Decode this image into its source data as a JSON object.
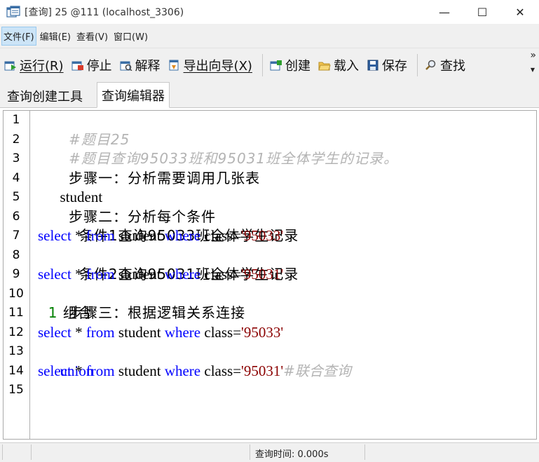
{
  "window": {
    "title": "[查询] 25 @111 (localhost_3306)",
    "minimize": "—",
    "maximize": "☐",
    "close": "✕"
  },
  "menubar": {
    "items": [
      "文件(F)",
      "编辑(E)",
      "查看(V)",
      "窗口(W)"
    ]
  },
  "toolbar": {
    "run": "运行(R)",
    "stop": "停止",
    "explain": "解释",
    "export_wizard": "导出向导(X)",
    "create": "创建",
    "load": "载入",
    "save": "保存",
    "find": "查找",
    "more": "»"
  },
  "tabs": {
    "query_builder": "查询创建工具",
    "query_editor": "查询编辑器"
  },
  "editor": {
    "line_numbers": [
      "1",
      "2",
      "3",
      "4",
      "5",
      "6",
      "7",
      "8",
      "9",
      "10",
      "11",
      "12",
      "13",
      "14",
      "15"
    ],
    "lines": {
      "l1": "#题目25",
      "l2": "#题目查询95033班和95031班全体学生的记录。",
      "l3": "步骤一：分析需要调用几张表",
      "l4": "student",
      "l5": "步骤二：分析每个条件",
      "l6": "  条件1查询95033班全体学生记录",
      "l7_kw1": "select",
      "l7_p1": " * ",
      "l7_kw2": "from",
      "l7_p2": " student ",
      "l7_kw3": "where",
      "l7_p3": " class=",
      "l7_str": "'95033'",
      "l8": "  条件2查询95031班全体学生记录",
      "l9_kw1": "select",
      "l9_p1": " * ",
      "l9_kw2": "from",
      "l9_p2": " student ",
      "l9_kw3": "where",
      "l9_p3": " class=",
      "l9_str": "'95031'",
      "l10": "步骤三：根据逻辑关系连接",
      "l11_num": "  1",
      "l11_txt": " 组合",
      "l12_kw1": "select",
      "l12_p1": " * ",
      "l12_kw2": "from",
      "l12_p2": " student ",
      "l12_kw3": "where",
      "l12_p3": " class=",
      "l12_str": "'95033'",
      "l13_kw": "union",
      "l14_kw1": "select",
      "l14_p1": " * ",
      "l14_kw2": "from",
      "l14_p2": " student ",
      "l14_kw3": "where",
      "l14_p3": " class=",
      "l14_str": "'95031'",
      "l14_cmt": "#联合查询"
    }
  },
  "statusbar": {
    "query_time": "查询时间: 0.000s"
  },
  "colors": {
    "keyword": "#0000ff",
    "string": "#8b0000",
    "comment": "#b4b4b4",
    "number": "#008000",
    "chrome": "#f0f0f0"
  },
  "icons": [
    "app-icon",
    "run-icon",
    "stop-icon",
    "explain-icon",
    "export-icon",
    "create-icon",
    "load-icon",
    "save-icon",
    "find-icon"
  ]
}
